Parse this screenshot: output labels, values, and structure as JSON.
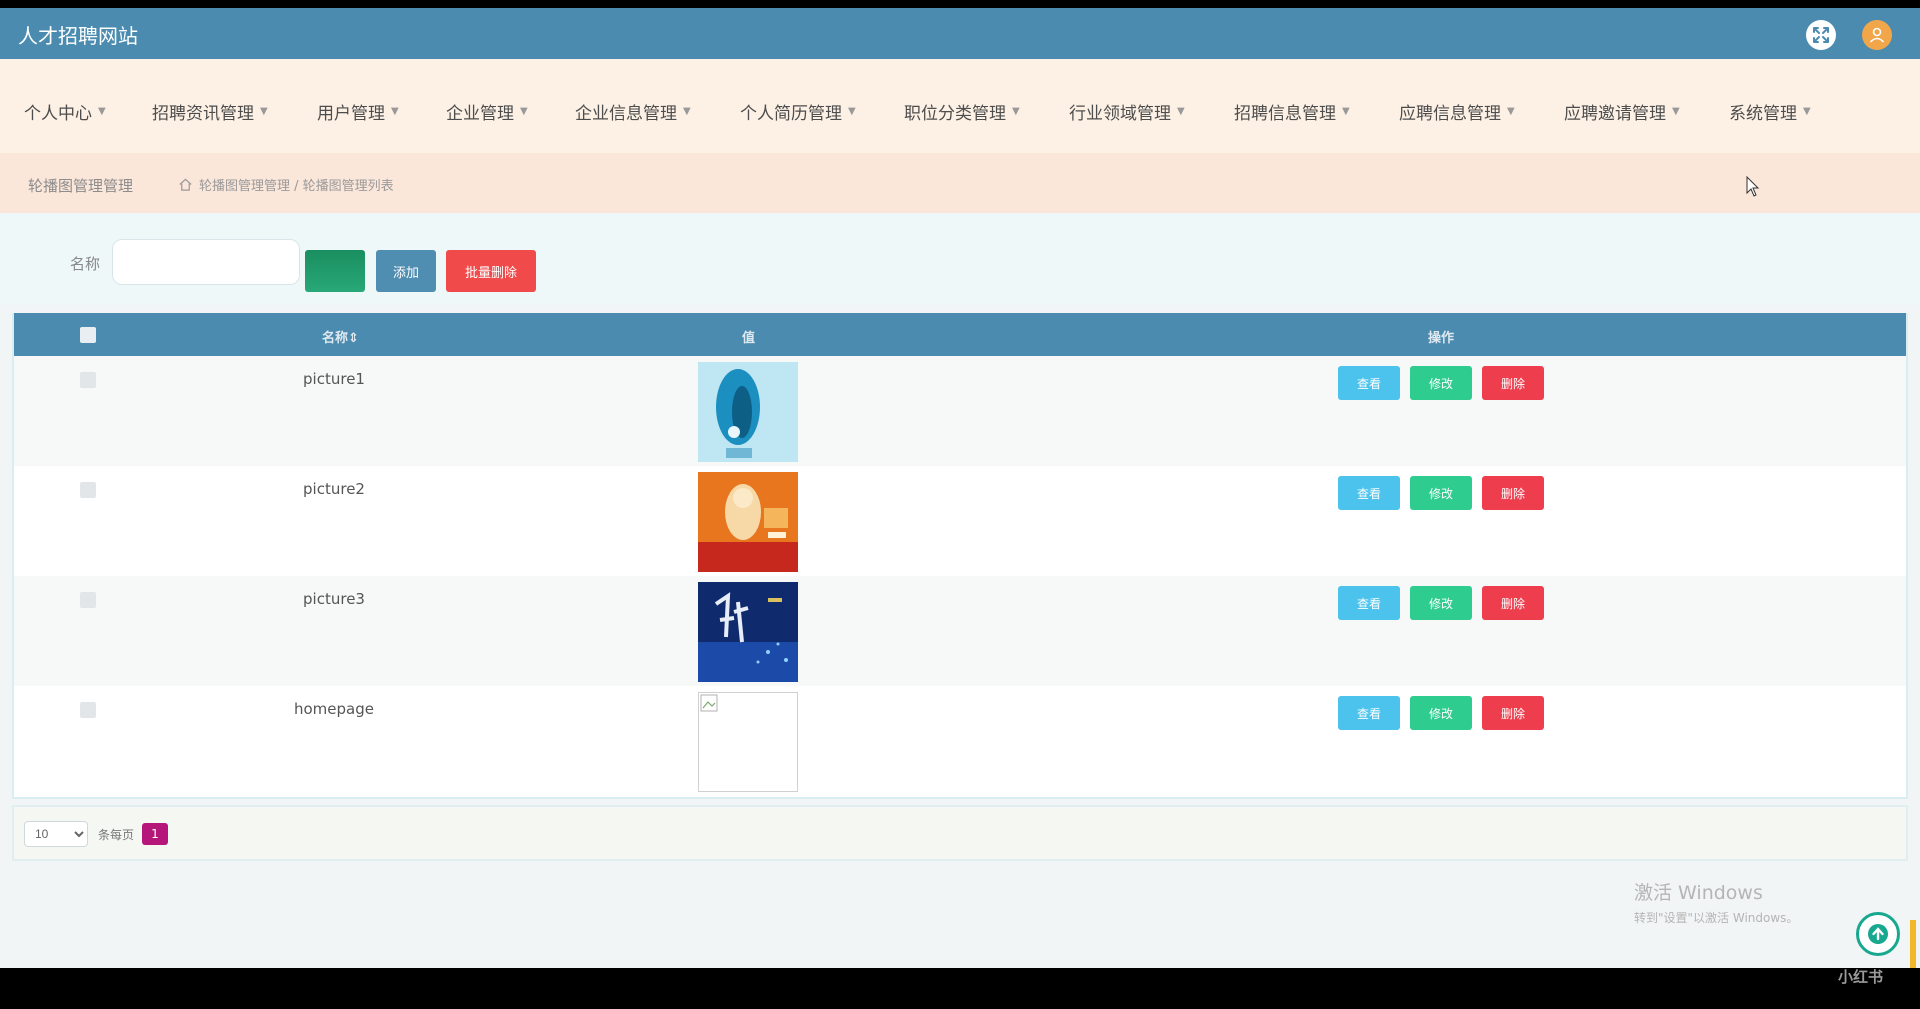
{
  "header": {
    "title": "人才招聘网站"
  },
  "nav": [
    {
      "label": "个人中心"
    },
    {
      "label": "招聘资讯管理"
    },
    {
      "label": "用户管理"
    },
    {
      "label": "企业管理"
    },
    {
      "label": "企业信息管理"
    },
    {
      "label": "个人简历管理"
    },
    {
      "label": "职位分类管理"
    },
    {
      "label": "行业领域管理"
    },
    {
      "label": "招聘信息管理"
    },
    {
      "label": "应聘信息管理"
    },
    {
      "label": "应聘邀请管理"
    },
    {
      "label": "系统管理"
    }
  ],
  "breadcrumb": {
    "title": "轮播图管理管理",
    "path": "轮播图管理管理 / 轮播图管理列表"
  },
  "search": {
    "label": "名称",
    "value": "",
    "placeholder": "",
    "search_label": "",
    "add_label": "添加",
    "batch_delete_label": "批量删除"
  },
  "table": {
    "columns": {
      "name": "名称",
      "value": "值",
      "actions": "操作"
    },
    "rows": [
      {
        "name": "picture1",
        "image": "blue-sculpture"
      },
      {
        "name": "picture2",
        "image": "orange-poster"
      },
      {
        "name": "picture3",
        "image": "dark-blue-poster"
      },
      {
        "name": "homepage",
        "image": "broken-image"
      }
    ],
    "actions": {
      "view": "查看",
      "edit": "修改",
      "delete": "删除"
    }
  },
  "pagination": {
    "page_size": "10",
    "per_page_label": "条每页",
    "current_page": "1"
  },
  "watermark": {
    "line1": "激活 Windows",
    "line2": "转到\"设置\"以激活 Windows。"
  },
  "corner_tag": "小红书",
  "colors": {
    "header": "#4b8bb0",
    "nav_bg": "#fdf1e6",
    "view": "#4cc3ed",
    "edit": "#2ecc8f",
    "delete": "#ee3e4e",
    "page_active": "#b4167a"
  }
}
